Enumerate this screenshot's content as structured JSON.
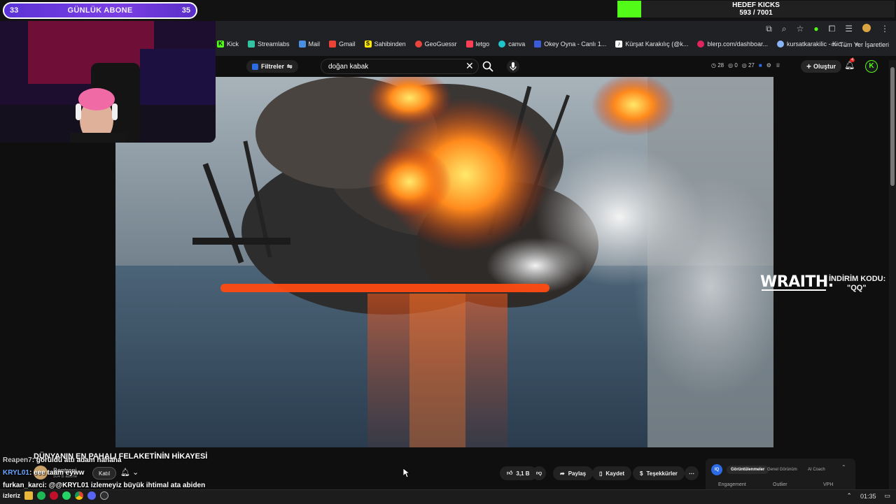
{
  "overlay": {
    "sub_goal": {
      "start": "33",
      "label": "GÜNLÜK ABONE",
      "end": "35"
    },
    "kicks_goal": {
      "title": "HEDEF KICKS",
      "count": "593 / 7001",
      "progress": 0.085
    }
  },
  "browser": {
    "bookmarks": [
      {
        "label": "Kick",
        "icon": "kick-icon",
        "color": "#53fc18"
      },
      {
        "label": "Streamlabs",
        "icon": "streamlabs-icon",
        "color": "#31c3a2"
      },
      {
        "label": "Mail",
        "icon": "mail-icon",
        "color": "#4a90e2"
      },
      {
        "label": "Gmail",
        "icon": "gmail-icon",
        "color": "#ea4335"
      },
      {
        "label": "Sahibinden",
        "icon": "sahibinden-icon",
        "color": "#ffe800"
      },
      {
        "label": "GeoGuessr",
        "icon": "map-pin-icon",
        "color": "#e8453c"
      },
      {
        "label": "letgo",
        "icon": "letgo-icon",
        "color": "#ff3f55"
      },
      {
        "label": "canva",
        "icon": "canva-icon",
        "color": "#20c4cb"
      },
      {
        "label": "Okey Oyna - Canlı 1...",
        "icon": "okey-icon",
        "color": "#3b5bdb"
      },
      {
        "label": "Kürşat Karakılıç (@k...",
        "icon": "tiktok-icon",
        "color": "#ffffff"
      },
      {
        "label": "blerp.com/dashboar...",
        "icon": "blerp-icon",
        "color": "#e0245e"
      },
      {
        "label": "kursatkarakilic - Kic...",
        "icon": "globe-icon",
        "color": "#8ab4f8"
      }
    ],
    "all_bookmarks": "Tüm Yer İşaretleri"
  },
  "youtube": {
    "filters_label": "Filtreler",
    "search_value": "doğan kabak",
    "stats": [
      "28",
      "0",
      "27"
    ],
    "create_label": "Oluştur",
    "notification_count": "4",
    "video_title": "DÜNYANIN EN PAHALI FELAKETİNİN HİKAYESİ",
    "channel_name": "Bentropi",
    "channel_subs": "504 B abone",
    "join_label": "Katıl",
    "like_count": "3,1 B",
    "share_label": "Paylaş",
    "save_label": "Kaydet",
    "thanks_label": "Teşekkürler",
    "ext_tabs": [
      "Görüntülenmeler",
      "Genel Görünüm",
      "AI Coach"
    ],
    "ext_labels": [
      "Engagement",
      "Outlier",
      "VPH"
    ]
  },
  "sponsor": {
    "brand": "WRAITH.",
    "line1": "İNDİRİM KODU:",
    "line2": "\"QQ\""
  },
  "chat": [
    {
      "user": "Reapen7",
      "message": ": görüldü attı adam hahaha"
    },
    {
      "user": "KRYL01",
      "message": ": eee taam eyww"
    },
    {
      "user": "furkan_karci",
      "message": ": @@KRYL01 izlemeyiz büyük ihtimal ata abiden"
    }
  ],
  "taskbar": {
    "left_label": "izleriz",
    "time": "01:35"
  },
  "colors": {
    "kick_green": "#53fc18",
    "goal_purple": "#6a38dc"
  }
}
